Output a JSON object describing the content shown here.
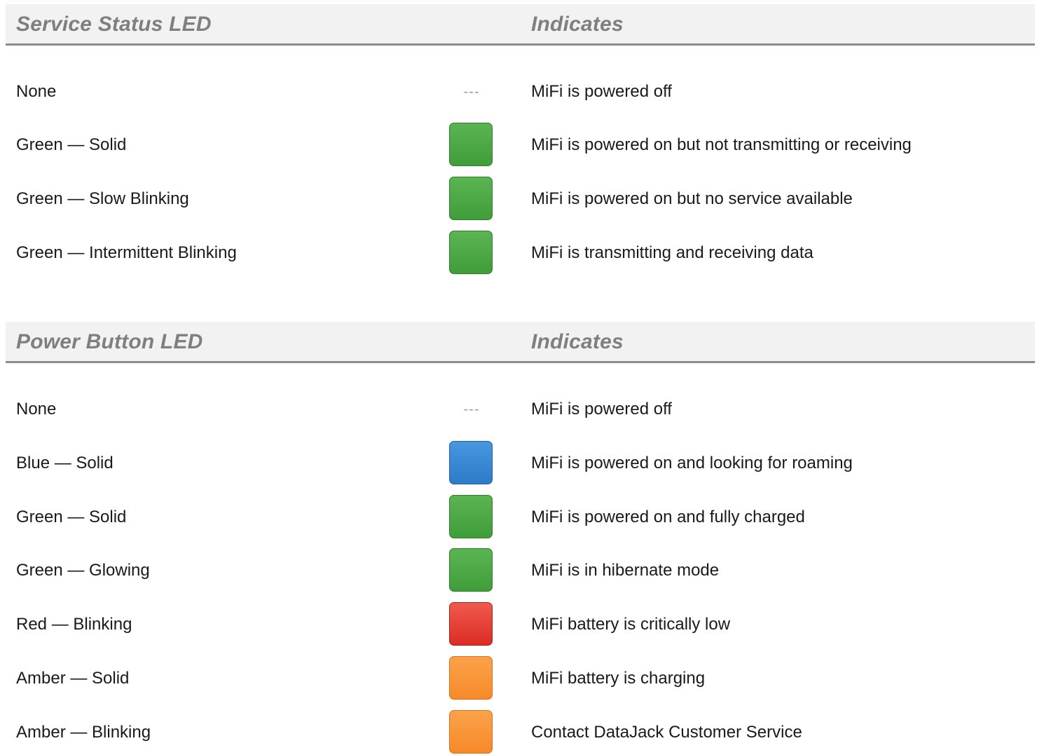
{
  "sections": [
    {
      "header": {
        "left": "Service Status LED",
        "right": "Indicates"
      },
      "rows": [
        {
          "state": "None",
          "led": "---",
          "color": "none",
          "meaning": "MiFi is powered off"
        },
        {
          "state": "Green — Solid",
          "led": "",
          "color": "#4ca946",
          "meaning": "MiFi is powered on but not transmitting or receiving"
        },
        {
          "state": "Green — Slow Blinking",
          "led": "",
          "color": "#4ca946",
          "meaning": "MiFi is powered on but no service available"
        },
        {
          "state": "Green — Intermittent Blinking",
          "led": "",
          "color": "#4ca946",
          "meaning": "MiFi is transmitting and receiving data"
        }
      ]
    },
    {
      "header": {
        "left": "Power Button LED",
        "right": "Indicates"
      },
      "rows": [
        {
          "state": "None",
          "led": "---",
          "color": "none",
          "meaning": "MiFi is powered off"
        },
        {
          "state": "Blue — Solid",
          "led": "",
          "color": "#3789d6",
          "meaning": "MiFi is powered on and looking for roaming"
        },
        {
          "state": "Green — Solid",
          "led": "",
          "color": "#4ca946",
          "meaning": "MiFi is powered on and fully charged"
        },
        {
          "state": "Green — Glowing",
          "led": "",
          "color": "#4ca946",
          "meaning": "MiFi is in hibernate mode"
        },
        {
          "state": "Red — Blinking",
          "led": "",
          "color": "#e6423a",
          "meaning": "MiFi battery is critically low"
        },
        {
          "state": "Amber — Solid",
          "led": "",
          "color": "#f8962f",
          "meaning": "MiFi battery is charging"
        },
        {
          "state": "Amber — Blinking",
          "led": "",
          "color": "#f8962f",
          "meaning": "Contact DataJack Customer Service"
        }
      ]
    }
  ]
}
